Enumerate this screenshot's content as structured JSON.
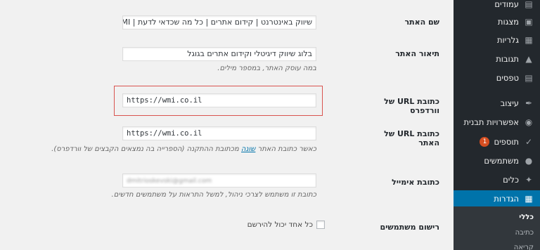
{
  "sidebar": {
    "items": [
      {
        "label": "עמודים",
        "icon": "pages-icon"
      },
      {
        "label": "מצגות",
        "icon": "slides-icon"
      },
      {
        "label": "גלריות",
        "icon": "gallery-icon"
      },
      {
        "label": "תגובות",
        "icon": "comments-icon"
      },
      {
        "label": "טפסים",
        "icon": "forms-icon"
      },
      {
        "label": "עיצוב",
        "icon": "paint-brush-icon"
      },
      {
        "label": "אפשרויות תבנית",
        "icon": "theme-options-icon"
      },
      {
        "label": "תוספים",
        "icon": "plugins-icon",
        "badge": "1"
      },
      {
        "label": "משתמשים",
        "icon": "users-icon"
      },
      {
        "label": "כלים",
        "icon": "wrench-icon"
      },
      {
        "label": "הגדרות",
        "icon": "settings-icon"
      }
    ],
    "submenu": [
      {
        "label": "כללי"
      },
      {
        "label": "כתיבה"
      },
      {
        "label": "קריאה"
      }
    ]
  },
  "colors": {
    "sidebar_bg": "#23282d",
    "active": "#0073aa",
    "badge": "#d54e21",
    "highlight": "#d9534f"
  },
  "form": {
    "site_title": {
      "label": "שם האתר",
      "value": "שיווק באינטרנט | קידום אתרים | כל מה שכדאי לדעת | WMI"
    },
    "tagline": {
      "label": "תיאור האתר",
      "value": "בלוג שיווק דיגיטלי וקידום אתרים בגוגל",
      "desc": "במה עוסק האתר, במספר מילים."
    },
    "wp_url": {
      "label": "כתובת URL של וורדפרס",
      "value": "https://wmi.co.il"
    },
    "site_url": {
      "label": "כתובת URL של האתר",
      "value": "https://wmi.co.il",
      "desc_before": "כאשר כתובת האתר ",
      "desc_link": "שונה",
      "desc_after": " מכתובת ההתקנה (הספרייה בה נמצאים הקבצים של וורדפרס)."
    },
    "email": {
      "label": "כתובת אימייל",
      "value": "dmitrioskevski@gmail.com",
      "desc": "כתובת זו משתמש לצרכי ניהול, למשל התראות על משתמשים חדשים."
    },
    "membership": {
      "label": "רישום משתמשים",
      "checkbox_label": "כל אחד יכול להירשם"
    }
  }
}
